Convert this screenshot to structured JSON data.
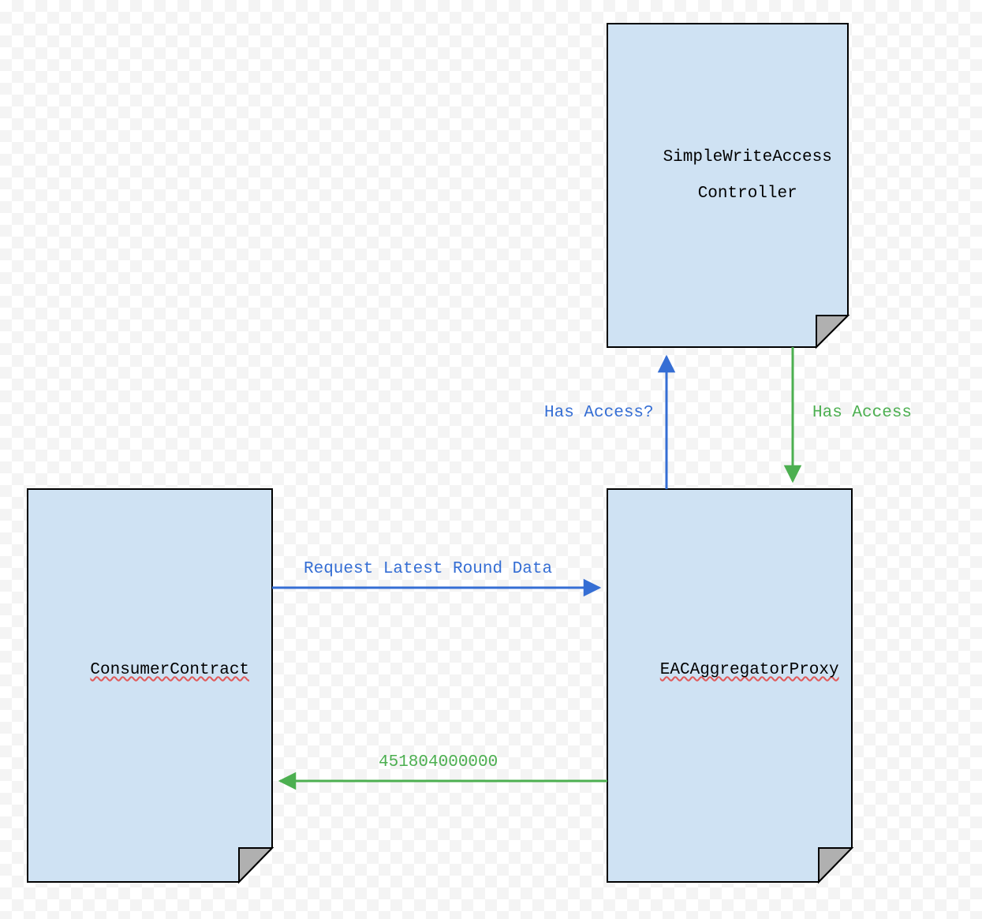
{
  "diagram": {
    "nodes": {
      "consumer": {
        "label": "ConsumerContract"
      },
      "eac": {
        "label": "EACAggregatorProxy"
      },
      "swac": {
        "line1": "SimpleWriteAccess",
        "line2": "Controller"
      }
    },
    "edges": {
      "request": {
        "label": "Request Latest Round Data"
      },
      "response": {
        "label": "451804000000"
      },
      "hasAccessQ": {
        "label": "Has Access?"
      },
      "hasAccess": {
        "label": "Has Access"
      }
    },
    "colors": {
      "nodeFill": "#cfe2f3",
      "nodeStroke": "#000000",
      "foldFill": "#b0b0b0",
      "blue": "#356ed4",
      "green": "#4caf50"
    }
  }
}
